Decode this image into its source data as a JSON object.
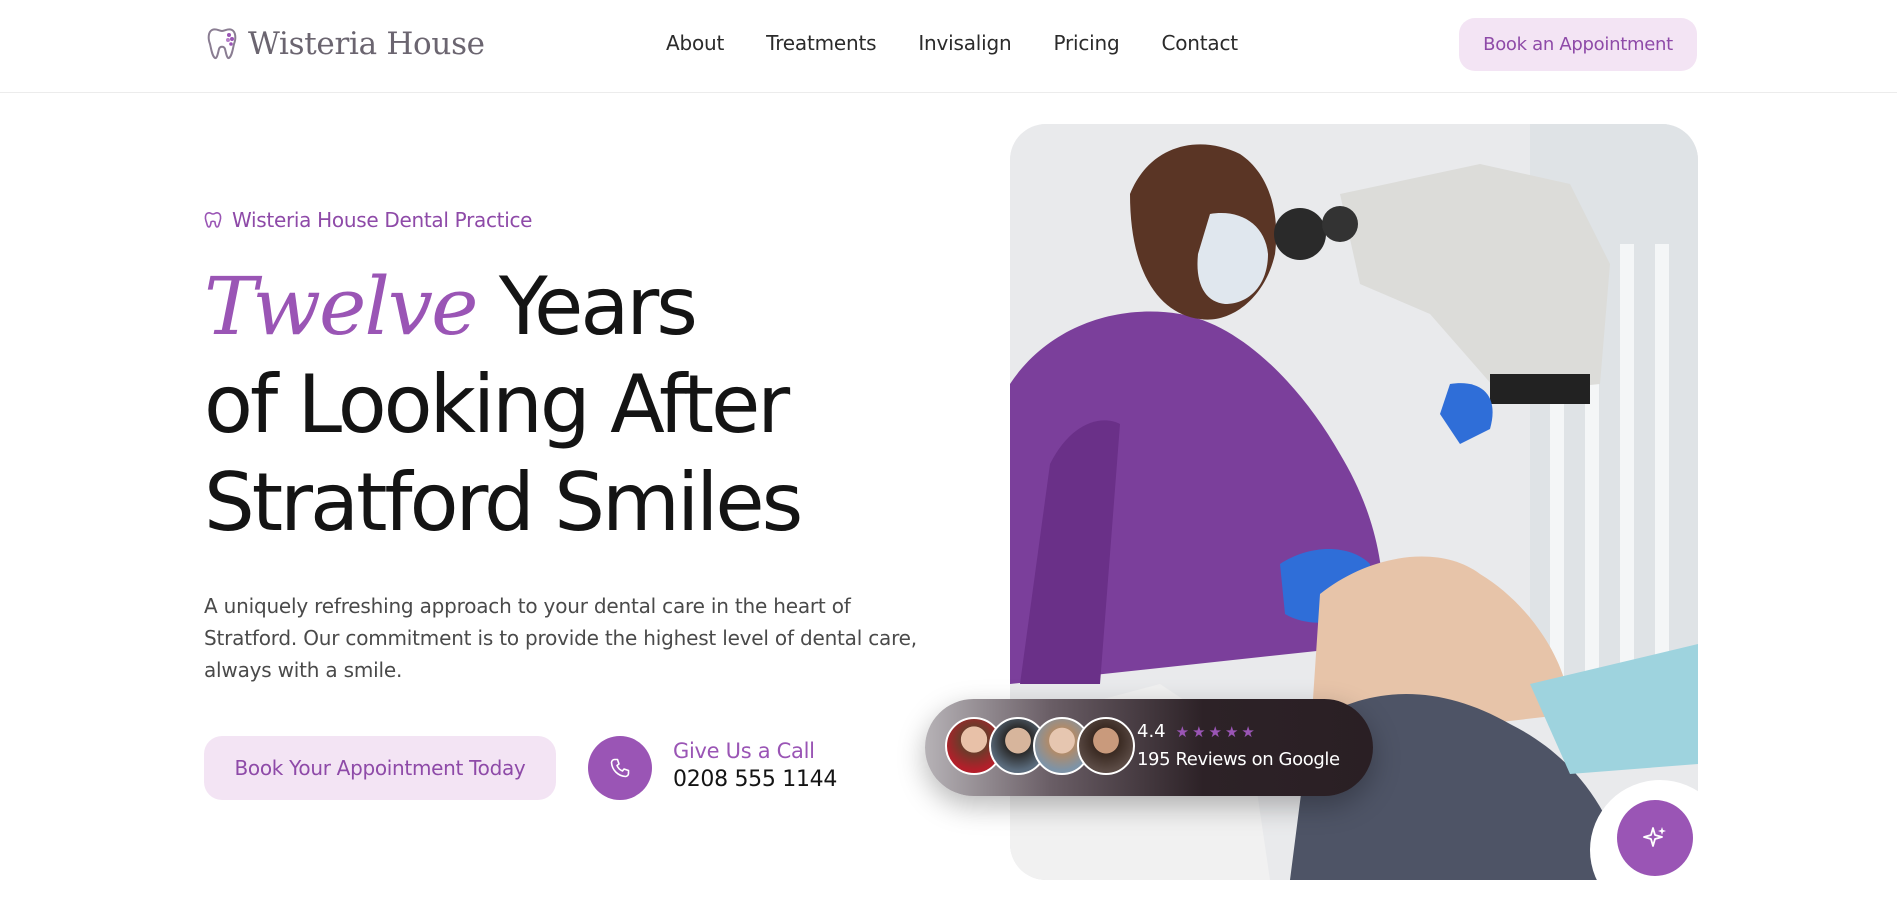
{
  "brand": {
    "name": "Wisteria House",
    "icon": "tooth-icon",
    "accent": "#9a55b5"
  },
  "nav": {
    "items": [
      "About",
      "Treatments",
      "Invisalign",
      "Pricing",
      "Contact"
    ]
  },
  "header": {
    "book_label": "Book an Appointment"
  },
  "hero": {
    "eyebrow": "Wisteria House Dental Practice",
    "headline_accent": "Twelve",
    "headline_line1_rest": "Years",
    "headline_line2": "of Looking After",
    "headline_line3": "Stratford Smiles",
    "lead": "A uniquely refreshing approach to your dental care in the heart of Stratford. Our commitment is to provide the highest level of dental care, always with a smile.",
    "cta_label": "Book Your Appointment Today",
    "call_label": "Give Us a Call",
    "call_number": "0208 555 1144"
  },
  "reviews": {
    "rating": "4.4",
    "stars": "★★★★★",
    "text": "195 Reviews on Google"
  },
  "icons": {
    "phone": "phone-icon",
    "sparkle": "sparkle-icon"
  }
}
